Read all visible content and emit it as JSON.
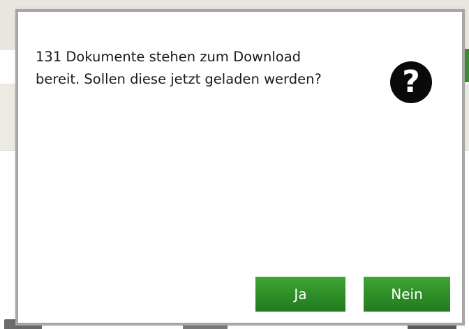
{
  "dialog": {
    "message": "131 Dokumente stehen zum Download\nbereit. Sollen diese jetzt geladen werden?",
    "icon": "question-icon",
    "icon_glyph": "?",
    "yes_label": "Ja",
    "no_label": "Nein"
  },
  "colors": {
    "button_green": "#2f8f28",
    "dialog_border": "#a6a6a6",
    "icon_background": "#0a0a0a",
    "app_background": "#e9e6df"
  }
}
